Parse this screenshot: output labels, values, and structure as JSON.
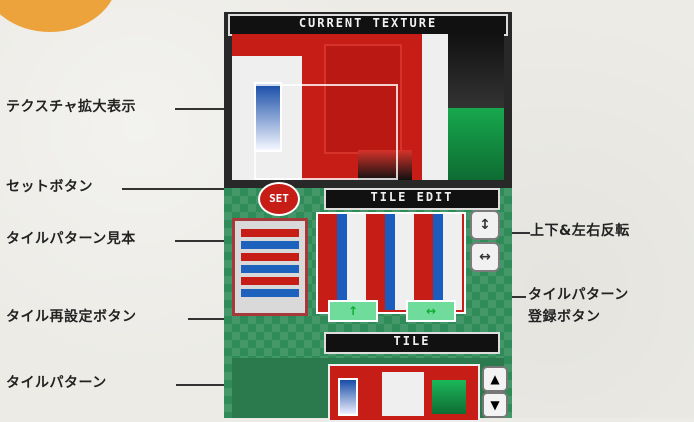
{
  "labels": {
    "texture_zoom": "テクスチャ拡大表示",
    "set_button": "セットボタン",
    "tile_pattern_sample": "タイルパターン見本",
    "tile_reset_button": "タイル再設定ボタン",
    "tile_pattern": "タイルパターン",
    "flip": "上下&左右反転",
    "register_line1": "タイルパターン",
    "register_line2": "登録ボタン"
  },
  "screen": {
    "current_texture_title": "CURRENT TEXTURE",
    "tile_edit_title": "TILE EDIT",
    "tile_title": "TILE",
    "set_label": "SET",
    "flip_vertical_icon": "↕",
    "flip_horizontal_icon": "↔",
    "tile_reset_icon": "↑",
    "register_icon": "↔",
    "strip_up_icon": "▲",
    "strip_down_icon": "▼"
  },
  "colors": {
    "accent_orange": "#eda33b",
    "texture_red": "#c61d16",
    "bg_green": "#2f8b58"
  }
}
